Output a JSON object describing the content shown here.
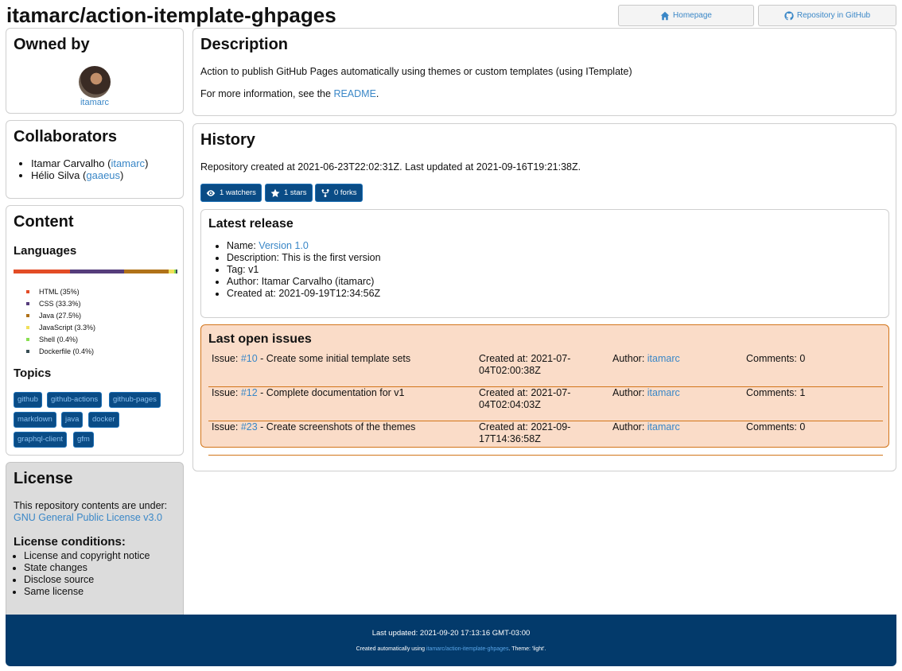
{
  "header": {
    "title": "itamarc/action-itemplate-ghpages",
    "homepage_label": "Homepage",
    "github_label": "Repository in GitHub"
  },
  "owned_by": {
    "heading": "Owned by",
    "owner": "itamarc"
  },
  "collaborators": {
    "heading": "Collaborators",
    "items": [
      {
        "name": "Itamar Carvalho",
        "login": "itamarc"
      },
      {
        "name": "Hélio Silva",
        "login": "gaaeus"
      }
    ]
  },
  "content": {
    "heading": "Content",
    "languages_heading": "Languages",
    "languages": [
      {
        "label": "HTML (35%)",
        "percent": 35,
        "color": "#e34c26"
      },
      {
        "label": "CSS (33.3%)",
        "percent": 33.3,
        "color": "#563d7c"
      },
      {
        "label": "Java (27.5%)",
        "percent": 27.5,
        "color": "#b07219"
      },
      {
        "label": "JavaScript (3.3%)",
        "percent": 3.3,
        "color": "#f1e05a"
      },
      {
        "label": "Shell (0.4%)",
        "percent": 0.4,
        "color": "#89e051"
      },
      {
        "label": "Dockerfile (0.4%)",
        "percent": 0.4,
        "color": "#384d54"
      }
    ],
    "topics_heading": "Topics",
    "topics": [
      "github",
      "github-actions",
      "github-pages",
      "markdown",
      "java",
      "docker",
      "graphql-client",
      "gfm"
    ]
  },
  "license": {
    "heading": "License",
    "text": "This repository contents are under:",
    "name": "GNU General Public License v3.0",
    "conditions_heading": "License conditions:",
    "conditions": [
      "License and copyright notice",
      "State changes",
      "Disclose source",
      "Same license"
    ]
  },
  "description": {
    "heading": "Description",
    "text": "Action to publish GitHub Pages automatically using themes or custom templates (using ITemplate)",
    "more_prefix": "For more information, see the ",
    "more_link": "README",
    "more_suffix": "."
  },
  "history": {
    "heading": "History",
    "text": "Repository created at 2021-06-23T22:02:31Z. Last updated at 2021-09-16T19:21:38Z.",
    "watchers": "1 watchers",
    "stars": "1 stars",
    "forks": "0 forks",
    "release": {
      "heading": "Latest release",
      "name_label": "Name: ",
      "name": "Version 1.0",
      "description": "Description: This is the first version",
      "tag": "Tag: v1",
      "author": "Author: Itamar Carvalho (itamarc)",
      "created": "Created at: 2021-09-19T12:34:56Z"
    },
    "issues": {
      "heading": "Last open issues",
      "issue_label": "Issue: ",
      "author_label": "Author: ",
      "items": [
        {
          "number": "#10",
          "title": " - Create some initial template sets",
          "created": "Created at: 2021-07-04T02:00:38Z",
          "author": "itamarc",
          "comments": "Comments: 0"
        },
        {
          "number": "#12",
          "title": " - Complete documentation for v1",
          "created": "Created at: 2021-07-04T02:04:03Z",
          "author": "itamarc",
          "comments": "Comments: 1"
        },
        {
          "number": "#23",
          "title": " - Create screenshots of the themes",
          "created": "Created at: 2021-09-17T14:36:58Z",
          "author": "itamarc",
          "comments": "Comments: 0"
        }
      ]
    }
  },
  "footer": {
    "updated": "Last updated: 2021-09-20 17:13:16 GMT-03:00",
    "created_prefix": "Created automatically using ",
    "created_link": "itamarc/action-itemplate-ghpages",
    "created_suffix": ". Theme: 'light'."
  }
}
